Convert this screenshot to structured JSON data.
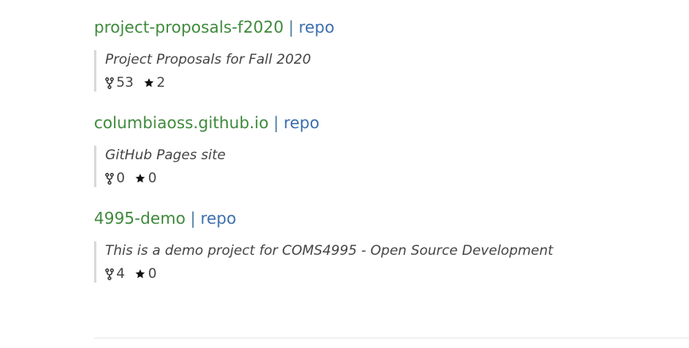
{
  "repos": [
    {
      "name": "project-proposals-f2020",
      "separator": "|",
      "link_label": "repo",
      "description": "Project Proposals for Fall 2020",
      "forks": "53",
      "stars": "2"
    },
    {
      "name": "columbiaoss.github.io",
      "separator": "|",
      "link_label": "repo",
      "description": "GitHub Pages site",
      "forks": "0",
      "stars": "0"
    },
    {
      "name": "4995-demo",
      "separator": "|",
      "link_label": "repo",
      "description": "This is a demo project for COMS4995 - Open Source Development",
      "forks": "4",
      "stars": "0"
    }
  ],
  "icons": {
    "fork": "fork-icon",
    "star": "star-icon"
  },
  "colors": {
    "repo_name": "#3f8a3c",
    "repo_link": "#3c6fae",
    "separator": "#4a7a9f",
    "text": "#444444",
    "quote_border": "#d9d9d9"
  }
}
